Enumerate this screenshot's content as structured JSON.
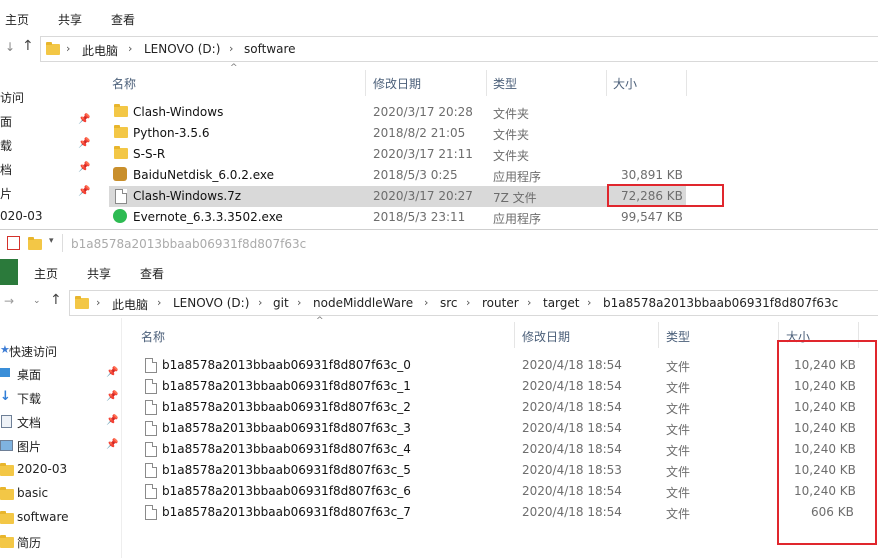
{
  "top_window": {
    "ribbon_tabs": [
      "主页",
      "共享",
      "查看"
    ],
    "address": [
      "此电脑",
      "LENOVO (D:)",
      "software"
    ],
    "columns": {
      "name": "名称",
      "date": "修改日期",
      "type": "类型",
      "size": "大小"
    },
    "sidebar": [
      {
        "label": "访问",
        "pinned": false
      },
      {
        "label": "面",
        "pinned": true
      },
      {
        "label": "载",
        "pinned": true
      },
      {
        "label": "档",
        "pinned": true
      },
      {
        "label": "片",
        "pinned": true
      },
      {
        "label": "020-03",
        "pinned": false
      }
    ],
    "rows": [
      {
        "name": "Clash-Windows",
        "date": "2020/3/17 20:28",
        "type": "文件夹",
        "size": "",
        "icon": "folder-icon"
      },
      {
        "name": "Python-3.5.6",
        "date": "2018/8/2 21:05",
        "type": "文件夹",
        "size": "",
        "icon": "folder-icon"
      },
      {
        "name": "S-S-R",
        "date": "2020/3/17 21:11",
        "type": "文件夹",
        "size": "",
        "icon": "folder-icon"
      },
      {
        "name": "BaiduNetdisk_6.0.2.exe",
        "date": "2018/5/3 0:25",
        "type": "应用程序",
        "size": "30,891 KB",
        "icon": "installer-icon"
      },
      {
        "name": "Clash-Windows.7z",
        "date": "2020/3/17 20:27",
        "type": "7Z 文件",
        "size": "72,286 KB",
        "icon": "file-icon",
        "selected": true
      },
      {
        "name": "Evernote_6.3.3.3502.exe",
        "date": "2018/5/3 23:11",
        "type": "应用程序",
        "size": "99,547 KB",
        "icon": "evernote-icon"
      }
    ]
  },
  "bottom_window": {
    "title": "b1a8578a2013bbaab06931f8d807f63c",
    "ribbon_tabs": [
      "主页",
      "共享",
      "查看"
    ],
    "address": [
      "此电脑",
      "LENOVO (D:)",
      "git",
      "nodeMiddleWare",
      "src",
      "router",
      "target",
      "b1a8578a2013bbaab06931f8d807f63c"
    ],
    "columns": {
      "name": "名称",
      "date": "修改日期",
      "type": "类型",
      "size": "大小"
    },
    "sidebar": [
      {
        "label": "快速访问",
        "icon": "star-icon",
        "pinned": false
      },
      {
        "label": "桌面",
        "icon": "desktop-icon",
        "pinned": true
      },
      {
        "label": "下载",
        "icon": "download-icon",
        "pinned": true
      },
      {
        "label": "文档",
        "icon": "document-icon",
        "pinned": true
      },
      {
        "label": "图片",
        "icon": "picture-icon",
        "pinned": true
      },
      {
        "label": "2020-03",
        "icon": "folder-icon",
        "pinned": false
      },
      {
        "label": "basic",
        "icon": "folder-icon",
        "pinned": false
      },
      {
        "label": "software",
        "icon": "folder-icon",
        "pinned": false
      },
      {
        "label": "简历",
        "icon": "folder-icon",
        "pinned": false
      }
    ],
    "rows": [
      {
        "name": "b1a8578a2013bbaab06931f8d807f63c_0",
        "date": "2020/4/18 18:54",
        "type": "文件",
        "size": "10,240 KB"
      },
      {
        "name": "b1a8578a2013bbaab06931f8d807f63c_1",
        "date": "2020/4/18 18:54",
        "type": "文件",
        "size": "10,240 KB"
      },
      {
        "name": "b1a8578a2013bbaab06931f8d807f63c_2",
        "date": "2020/4/18 18:54",
        "type": "文件",
        "size": "10,240 KB"
      },
      {
        "name": "b1a8578a2013bbaab06931f8d807f63c_3",
        "date": "2020/4/18 18:54",
        "type": "文件",
        "size": "10,240 KB"
      },
      {
        "name": "b1a8578a2013bbaab06931f8d807f63c_4",
        "date": "2020/4/18 18:54",
        "type": "文件",
        "size": "10,240 KB"
      },
      {
        "name": "b1a8578a2013bbaab06931f8d807f63c_5",
        "date": "2020/4/18 18:53",
        "type": "文件",
        "size": "10,240 KB"
      },
      {
        "name": "b1a8578a2013bbaab06931f8d807f63c_6",
        "date": "2020/4/18 18:54",
        "type": "文件",
        "size": "10,240 KB"
      },
      {
        "name": "b1a8578a2013bbaab06931f8d807f63c_7",
        "date": "2020/4/18 18:54",
        "type": "文件",
        "size": "606 KB"
      }
    ]
  },
  "colors": {
    "highlight": "#e0262d",
    "selected_row": "#d9d9d9",
    "ribbon_active": "#2b7a3b"
  }
}
